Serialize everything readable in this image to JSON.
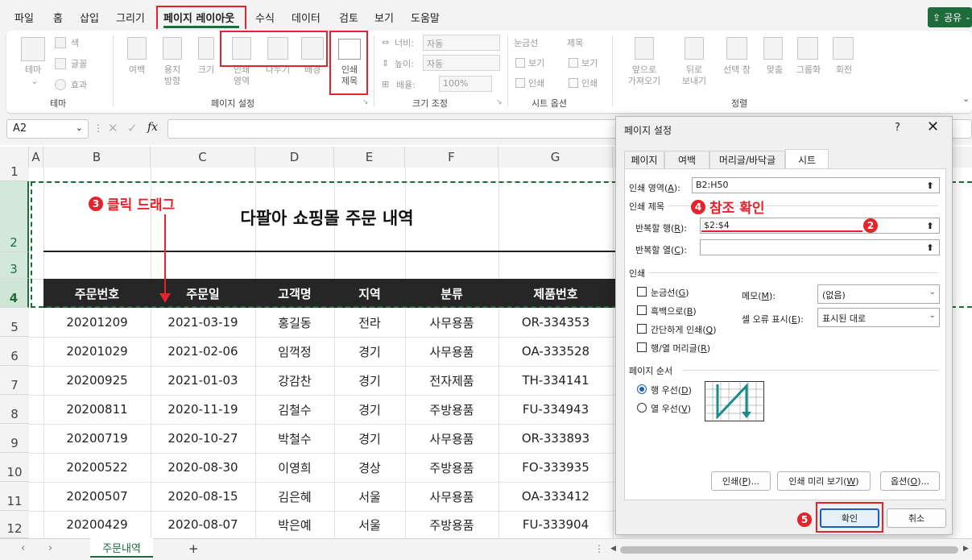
{
  "menu": {
    "items": [
      "파일",
      "홈",
      "삽입",
      "그리기",
      "페이지 레이아웃",
      "수식",
      "데이터",
      "검토",
      "보기",
      "도움말"
    ],
    "share": "공유"
  },
  "ribbon": {
    "theme": {
      "theme_btn": "테마",
      "colors": "색",
      "fonts": "글꼴",
      "effects": "효과",
      "group": "테마"
    },
    "page_setup": {
      "margins": "여백",
      "orientation_1": "용지",
      "orientation_2": "방향",
      "size": "크기",
      "print_area_1": "인쇄",
      "print_area_2": "영역",
      "breaks": "나누기",
      "background": "배경",
      "print_titles_1": "인쇄",
      "print_titles_2": "제목",
      "group": "페이지 설정"
    },
    "scale": {
      "width_label": "너비:",
      "width_value": "자동",
      "height_label": "높이:",
      "height_value": "자동",
      "scale_label": "배율:",
      "scale_value": "100%",
      "group": "크기 조정"
    },
    "sheet_options": {
      "gridlines": "눈금선",
      "headings": "제목",
      "view": "보기",
      "print": "인쇄",
      "group": "시트 옵션"
    },
    "arrange": {
      "bring_forward_1": "앞으로",
      "bring_forward_2": "가져오기",
      "send_backward_1": "뒤로",
      "send_backward_2": "보내기",
      "selection_pane": "선택 창",
      "align": "맞춤",
      "group_btn": "그룹화",
      "rotate": "회전",
      "group": "정렬"
    }
  },
  "formula_bar": {
    "name_box": "A2",
    "fx": "fx"
  },
  "columns": [
    "A",
    "B",
    "C",
    "D",
    "E",
    "F",
    "G"
  ],
  "rows": [
    "1",
    "2",
    "3",
    "4",
    "5",
    "6",
    "7",
    "8",
    "9",
    "10",
    "11",
    "12"
  ],
  "sheet": {
    "title": "다팔아 쇼핑몰 주문 내역",
    "headers": [
      "주문번호",
      "주문일",
      "고객명",
      "지역",
      "분류",
      "제품번호"
    ],
    "data": [
      [
        "20201209",
        "2021-03-19",
        "홍길동",
        "전라",
        "사무용품",
        "OR-334353"
      ],
      [
        "20201029",
        "2021-02-06",
        "임꺽정",
        "경기",
        "사무용품",
        "OA-333528"
      ],
      [
        "20200925",
        "2021-01-03",
        "강감찬",
        "경기",
        "전자제품",
        "TH-334141"
      ],
      [
        "20200811",
        "2020-11-19",
        "김철수",
        "경기",
        "주방용품",
        "FU-334943"
      ],
      [
        "20200719",
        "2020-10-27",
        "박철수",
        "경기",
        "사무용품",
        "OR-333893"
      ],
      [
        "20200522",
        "2020-08-30",
        "이영희",
        "경상",
        "주방용품",
        "FO-333935"
      ],
      [
        "20200507",
        "2020-08-15",
        "김은혜",
        "서울",
        "사무용품",
        "OA-333412"
      ],
      [
        "20200429",
        "2020-08-07",
        "박은예",
        "서울",
        "주방용품",
        "FU-333904"
      ]
    ]
  },
  "annotations": {
    "a2": "2",
    "a3_num": "3",
    "a3": "클릭 드래그",
    "a4_num": "4",
    "a4": "참조 확인",
    "a5": "5"
  },
  "dialog": {
    "title": "페이지 설정",
    "help": "?",
    "tabs": [
      "페이지",
      "여백",
      "머리글/바닥글",
      "시트"
    ],
    "print_area_label": "인쇄 영역(",
    "print_area_key": "A",
    "print_area_suffix": "):",
    "print_area_value": "B2:H50",
    "print_titles_section": "인쇄 제목",
    "repeat_rows_label": "반복할 행(",
    "repeat_rows_key": "R",
    "repeat_rows_value": "$2:$4",
    "repeat_cols_label": "반복할 열(",
    "repeat_cols_key": "C",
    "repeat_cols_value": "",
    "print_section": "인쇄",
    "chk_gridlines": "눈금선(",
    "chk_gridlines_key": "G",
    "chk_bw": "흑백으로(",
    "chk_bw_key": "B",
    "chk_draft": "간단하게 인쇄(",
    "chk_draft_key": "Q",
    "chk_headings": "행/열 머리글(",
    "chk_headings_key": "R",
    "comments_label": "메모(",
    "comments_key": "M",
    "comments_value": "(없음)",
    "errors_label": "셀 오류 표시(",
    "errors_key": "E",
    "errors_value": "표시된 대로",
    "order_section": "페이지 순서",
    "radio_down": "행 우선(",
    "radio_down_key": "D",
    "radio_over": "열 우선(",
    "radio_over_key": "V",
    "btn_print": "인쇄(",
    "btn_print_key": "P",
    "btn_preview": "인쇄 미리 보기(",
    "btn_preview_key": "W",
    "btn_options": "옵션(",
    "btn_options_key": "O",
    "btn_ok": "확인",
    "btn_cancel": "취소"
  },
  "statusbar": {
    "sheet_tab": "주문내역",
    "add": "+"
  },
  "colors": {
    "excel_green": "#1e6b3c",
    "annotation_red": "#e8222b",
    "dialog_blue": "#1a5fb4"
  }
}
